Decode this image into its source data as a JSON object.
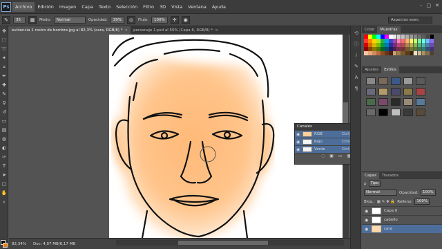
{
  "app": {
    "logo_text": "Ps"
  },
  "menu": {
    "items": [
      "Archivo",
      "Edición",
      "Imagen",
      "Capa",
      "Texto",
      "Selección",
      "Filtro",
      "3D",
      "Vista",
      "Ventana",
      "Ayuda"
    ],
    "active_index": 0
  },
  "window_controls": [
    "–",
    "□",
    "✕"
  ],
  "options_bar": {
    "brush_size": "35",
    "mode_label": "Modo:",
    "mode_value": "Normal",
    "opacity_label": "Opacidad:",
    "opacity_value": "39%",
    "flow_label": "Flujo:",
    "flow_value": "100%",
    "workspace": "Aspectos esen."
  },
  "doc_tabs": [
    {
      "label": "evidencia 1 rostro de bombre.jpg al 82,3% (cara, RGB/8) *",
      "active": true
    },
    {
      "label": "personaje 1.psd al 50% (Capa 6, RGB/8) *",
      "active": false
    }
  ],
  "status": {
    "zoom": "82,34%",
    "doc_info": "Doc: 4,07 MB/6,17 MB"
  },
  "swatches_panel": {
    "tabs": [
      "Color",
      "Muestras"
    ],
    "active_tab": 1,
    "colors": [
      "#ff0000",
      "#ffff00",
      "#00ff00",
      "#00ffff",
      "#0000ff",
      "#ff00ff",
      "#ffffff",
      "#ebebeb",
      "#d6d6d6",
      "#c2c2c2",
      "#adadad",
      "#999999",
      "#858585",
      "#707070",
      "#5c5c5c",
      "#474747",
      "#000000",
      "#ff3b30",
      "#ff8a00",
      "#ffd200",
      "#b5e61d",
      "#22b14c",
      "#00a2e8",
      "#3f48cc",
      "#a349a4",
      "#ff7fbf",
      "#ff6a6a",
      "#ffb26a",
      "#fff26a",
      "#c6ff6a",
      "#6aff9a",
      "#6afff4",
      "#6ac0ff",
      "#8f6aff",
      "#d40000",
      "#d46a00",
      "#d4b800",
      "#7fb800",
      "#009c3a",
      "#0079b8",
      "#2a2f9c",
      "#7d2a80",
      "#c4407a",
      "#b84a4a",
      "#b8844a",
      "#b8b04a",
      "#84b84a",
      "#4ab87c",
      "#4ab8b0",
      "#4a7cb8",
      "#6e4ab8",
      "#8a0000",
      "#8a4500",
      "#8a7800",
      "#527800",
      "#006626",
      "#004f78",
      "#1b1f66",
      "#521b54",
      "#80294f",
      "#7a2f2f",
      "#7a572f",
      "#7a752f",
      "#577a2f",
      "#2f7a52",
      "#2f7a75",
      "#2f527a",
      "#482f7a",
      "#f6c7a0",
      "#e8a87c",
      "#d48a5c",
      "#b86a3c",
      "#8c4a24",
      "#6a3418",
      "#4a2410",
      "#c7a46c",
      "#a47c44",
      "#7c5824",
      "#5c3c14",
      "#3c2408",
      "#f0e0c0",
      "#d0b890",
      "#b09060",
      "#807050",
      "#504030"
    ]
  },
  "adjustments_panel": {
    "tabs": [
      "Ajustes",
      "Estilos"
    ],
    "active_tab": 1,
    "styles": [
      "#888888",
      "#7a6a5a",
      "#3a5a8a",
      "#9a9a9a",
      "#5a5a5a",
      "#6a6a7a",
      "#b59a6a",
      "#4a4a6a",
      "#8a7a4a",
      "#aa4444",
      "#4a6a4a",
      "#7a4a6a",
      "#2a2a2a",
      "#9a8a7a",
      "#5a7a9a",
      "#6a6a6a",
      "#000000",
      "#c0c0c0",
      "#3a3a3a",
      "#5a4a3a"
    ]
  },
  "channels_panel": {
    "title": "Canales",
    "rows": [
      {
        "name": "RGB",
        "shortcut": "Ctrl+2"
      },
      {
        "name": "Rojo",
        "shortcut": "Ctrl+3"
      },
      {
        "name": "Verde",
        "shortcut": "Ctrl+4"
      }
    ],
    "footer_icons": [
      "◌",
      "▣",
      "▭",
      "▦"
    ]
  },
  "layers_panel": {
    "tabs": [
      "Capas",
      "Trazados"
    ],
    "active_tab": 0,
    "filter_label": "Tipo",
    "blend_mode": "Normal",
    "opacity_label": "Opacidad:",
    "opacity_value": "100%",
    "lock_label": "Bloq.:",
    "fill_label": "Relleno:",
    "fill_value": "100%",
    "layers": [
      {
        "name": "Capa 0",
        "selected": false
      },
      {
        "name": "cabello",
        "selected": false
      },
      {
        "name": "cara",
        "selected": true
      }
    ]
  }
}
